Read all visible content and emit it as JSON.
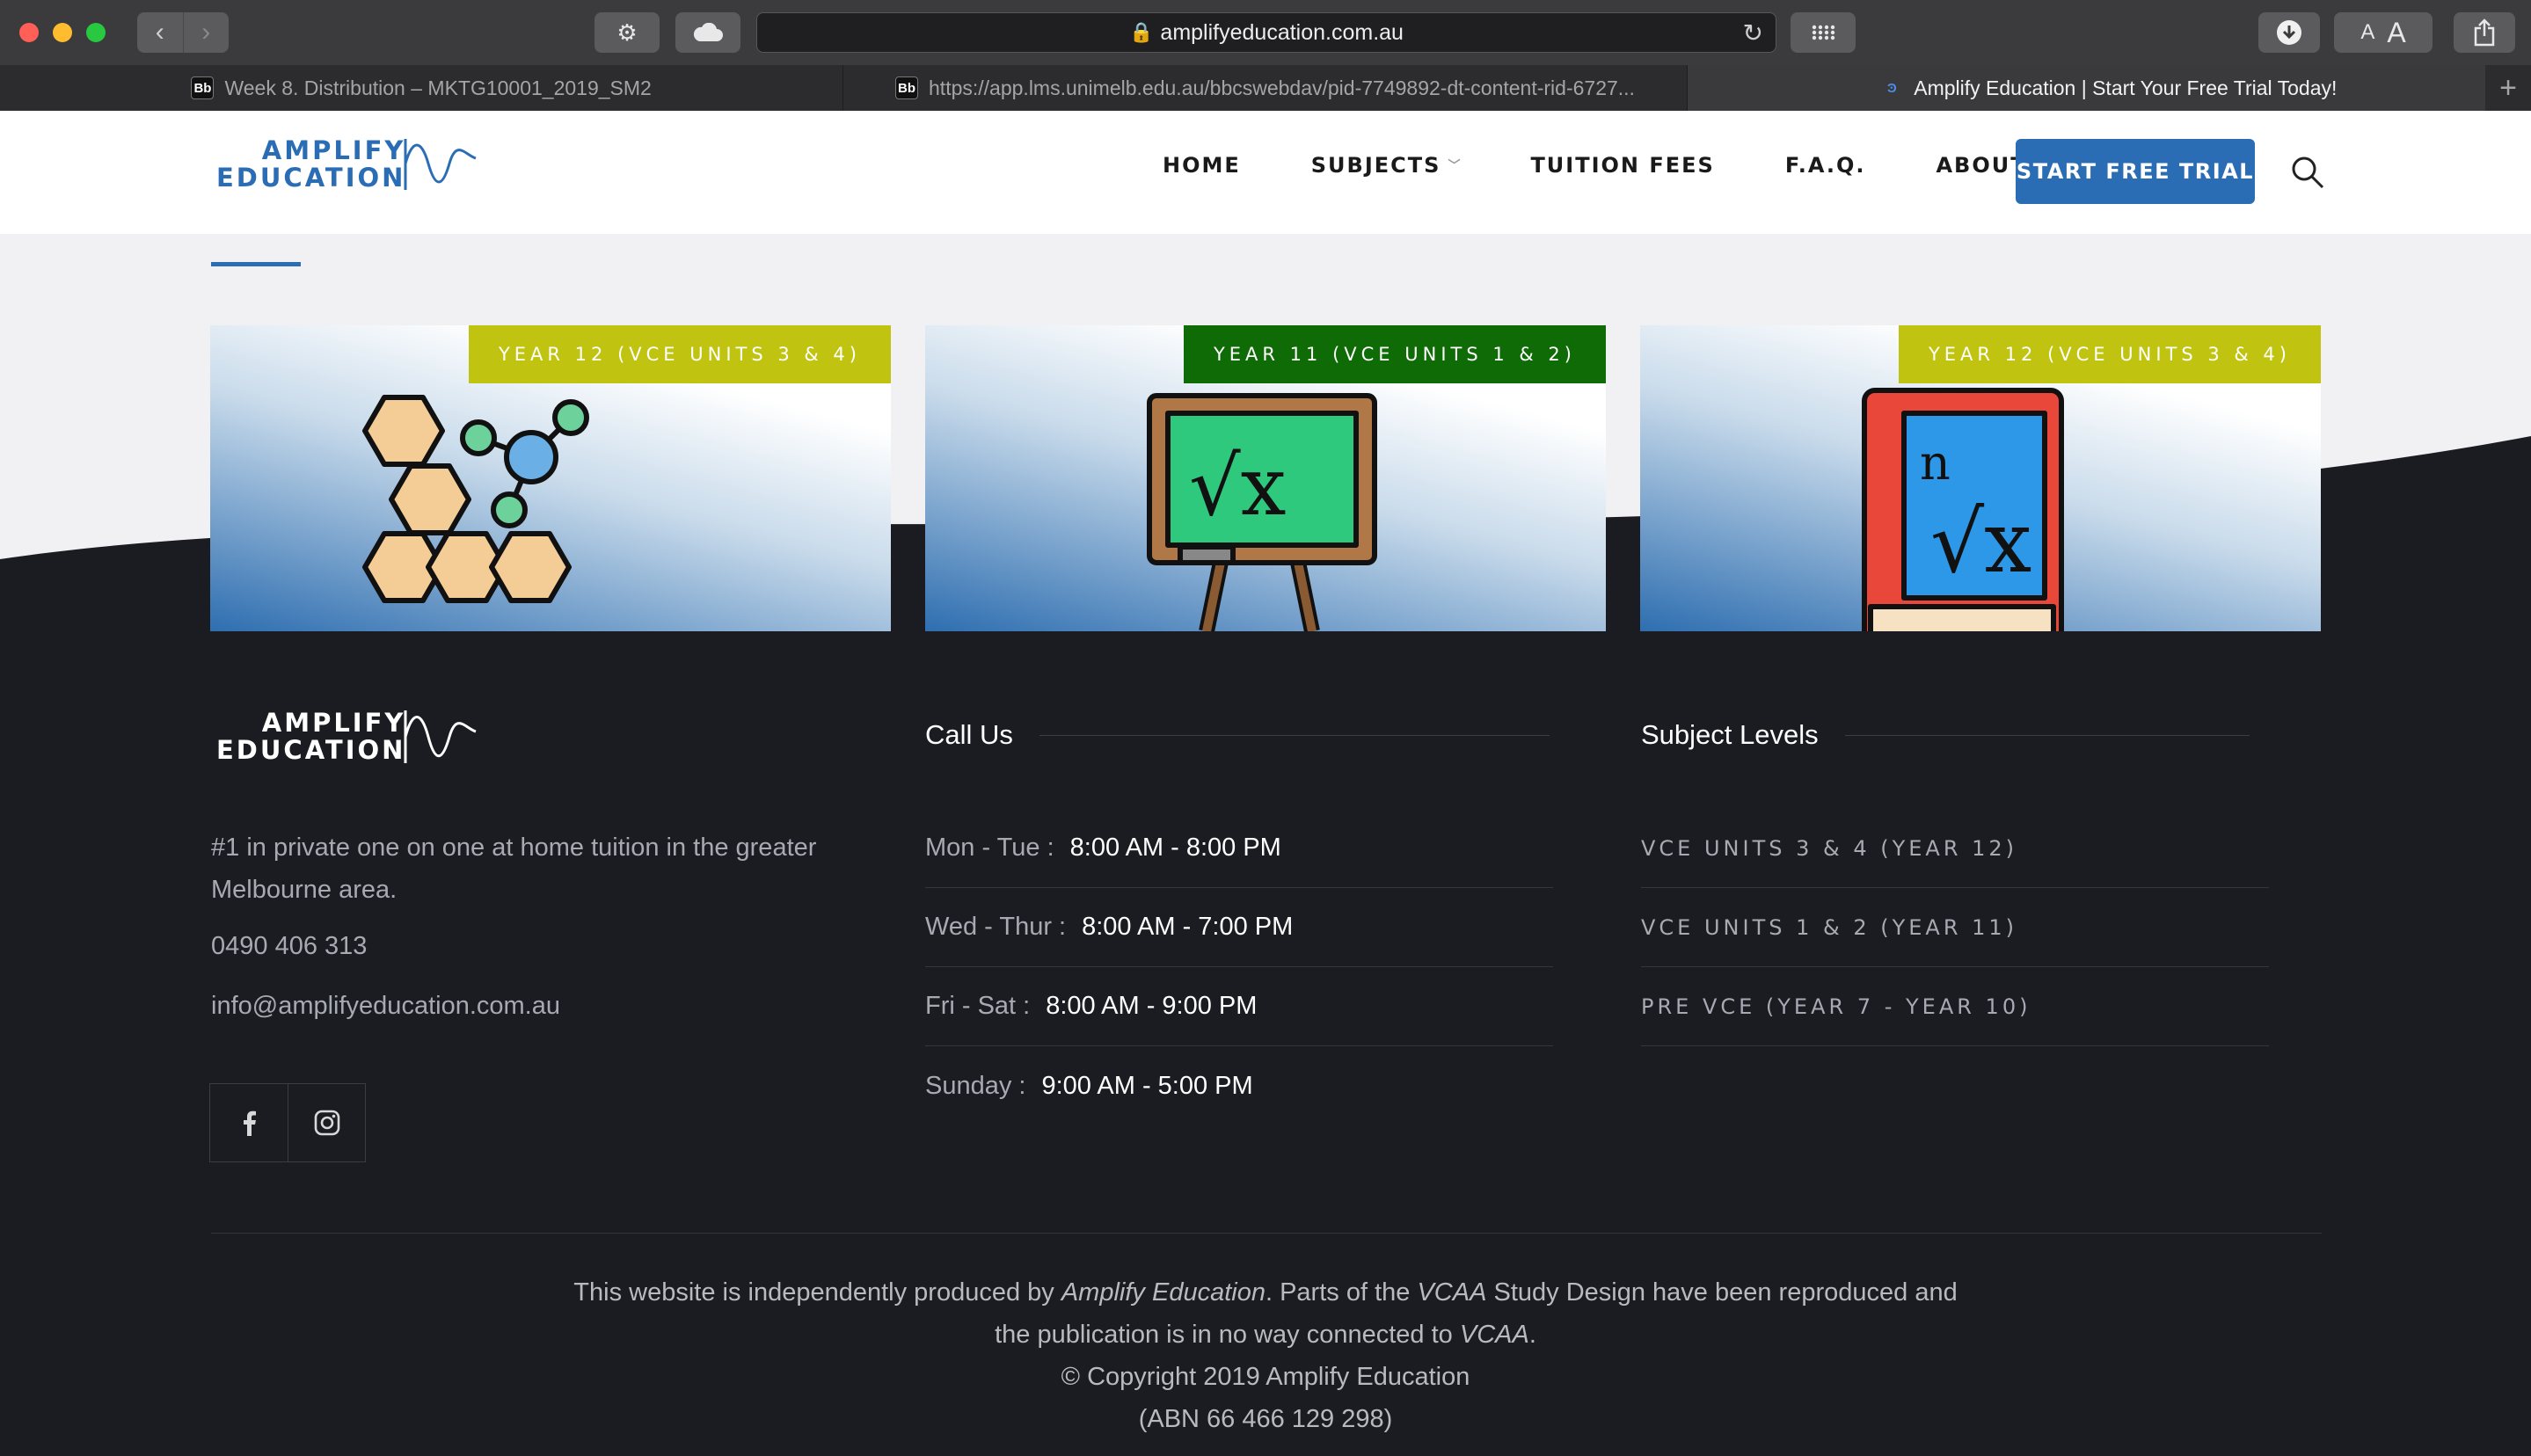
{
  "browser": {
    "url": "amplifyeducation.com.au",
    "tabs": [
      {
        "favicon": "Bb",
        "title": "Week 8. Distribution – MKTG10001_2019_SM2",
        "active": false
      },
      {
        "favicon": "Bb",
        "title": "https://app.lms.unimelb.edu.au/bbcswebdav/pid-7749892-dt-content-rid-6727...",
        "active": false
      },
      {
        "favicon": "Ͽ",
        "title": "Amplify Education | Start Your Free Trial Today!",
        "active": true
      }
    ],
    "font_small": "A",
    "font_large": "A"
  },
  "site": {
    "logo_line1": "AMPLIFY",
    "logo_line2": "EDUCATION",
    "nav": [
      {
        "label": "HOME",
        "dropdown": false
      },
      {
        "label": "SUBJECTS",
        "dropdown": true
      },
      {
        "label": "TUITION FEES",
        "dropdown": false
      },
      {
        "label": "F.A.Q.",
        "dropdown": false
      },
      {
        "label": "ABOUT",
        "dropdown": true
      }
    ],
    "cta": "START FREE TRIAL"
  },
  "cards": [
    {
      "badge": "YEAR 12 (VCE UNITS 3 & 4)",
      "badge_color": "#c0c411",
      "icon": "chemistry-molecule-icon"
    },
    {
      "badge": "YEAR 11 (VCE UNITS 1 & 2)",
      "badge_color": "#0e6b06",
      "icon": "chalkboard-sqrt-icon"
    },
    {
      "badge": "YEAR 12 (VCE UNITS 3 & 4)",
      "badge_color": "#c0c411",
      "icon": "math-book-icon"
    }
  ],
  "footer": {
    "about": "#1 in private one on one at home tuition in the greater Melbourne area.",
    "phone": "0490 406 313",
    "email": "info@amplifyeducation.com.au",
    "call_title": "Call Us",
    "hours": [
      {
        "day": "Mon - Tue :",
        "time": "8:00 AM - 8:00 PM"
      },
      {
        "day": "Wed - Thur :",
        "time": "8:00 AM - 7:00 PM"
      },
      {
        "day": "Fri - Sat :",
        "time": "8:00 AM - 9:00 PM"
      },
      {
        "day": "Sunday :",
        "time": "9:00 AM - 5:00 PM"
      }
    ],
    "levels_title": "Subject Levels",
    "levels": [
      "VCE UNITS 3 & 4 (YEAR 12)",
      "VCE UNITS 1 & 2 (YEAR 11)",
      "PRE VCE (YEAR 7 - YEAR 10)"
    ],
    "copy_pre": "This website is independently produced by ",
    "copy_brand": "Amplify Education",
    "copy_mid": ". Parts of the ",
    "copy_vcaa": "VCAA",
    "copy_post": " Study Design have been reproduced and",
    "copy_line2_pre": "the publication is in no way connected to ",
    "copy_line2_vcaa": "VCAA",
    "copy_line2_end": ".",
    "copyright": "© Copyright 2019 Amplify Education",
    "abn": "(ABN 66 466 129 298)"
  },
  "colors": {
    "brand_blue": "#2a6db5",
    "badge_lime": "#c0c411",
    "badge_green": "#0e6b06",
    "footer_bg": "#1b1c22"
  }
}
